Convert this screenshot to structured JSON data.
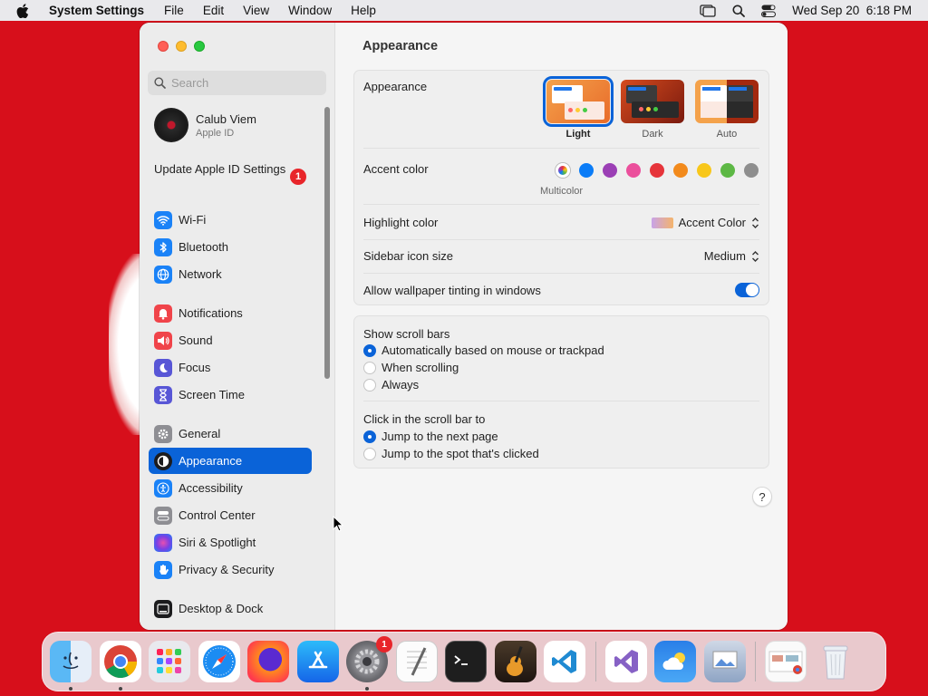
{
  "menubar": {
    "app_name": "System Settings",
    "items": [
      "File",
      "Edit",
      "View",
      "Window",
      "Help"
    ],
    "datetime": "Wed Sep 20  6:18 PM"
  },
  "sidebar": {
    "search_placeholder": "Search",
    "profile": {
      "name": "Calub Viem",
      "subtitle": "Apple ID"
    },
    "update": {
      "label": "Update Apple ID Settings",
      "badge": "1"
    },
    "items": [
      {
        "label": "Wi-Fi",
        "icon": "wifi-icon",
        "color": "#1a82f7"
      },
      {
        "label": "Bluetooth",
        "icon": "bluetooth-icon",
        "color": "#1a82f7"
      },
      {
        "label": "Network",
        "icon": "network-globe-icon",
        "color": "#1a82f7"
      },
      {
        "label": "Notifications",
        "icon": "notifications-bell-icon",
        "color": "#f0444a"
      },
      {
        "label": "Sound",
        "icon": "sound-speaker-icon",
        "color": "#f0444a"
      },
      {
        "label": "Focus",
        "icon": "focus-moon-icon",
        "color": "#5856d6"
      },
      {
        "label": "Screen Time",
        "icon": "hourglass-icon",
        "color": "#5856d6"
      },
      {
        "label": "General",
        "icon": "gear-icon",
        "color": "#8e8e93"
      },
      {
        "label": "Appearance",
        "icon": "appearance-icon",
        "color": "#1c1c1e"
      },
      {
        "label": "Accessibility",
        "icon": "accessibility-icon",
        "color": "#1a82f7"
      },
      {
        "label": "Control Center",
        "icon": "control-center-icon",
        "color": "#8e8e93"
      },
      {
        "label": "Siri & Spotlight",
        "icon": "siri-icon",
        "color": "#7b3fe4"
      },
      {
        "label": "Privacy & Security",
        "icon": "hand-icon",
        "color": "#1a82f7"
      },
      {
        "label": "Desktop & Dock",
        "icon": "desktop-dock-icon",
        "color": "#1c1c1e"
      }
    ]
  },
  "main": {
    "title": "Appearance",
    "appearance": {
      "label": "Appearance",
      "options": [
        "Light",
        "Dark",
        "Auto"
      ],
      "selected": "Light"
    },
    "accent": {
      "label": "Accent color",
      "selected_name": "Multicolor",
      "colors": [
        "#8a5cf6",
        "#0a7cf7",
        "#9b3fb5",
        "#eb4f9c",
        "#e6343a",
        "#f28a1c",
        "#f8c71a",
        "#5db845",
        "#8e8e8e"
      ]
    },
    "highlight": {
      "label": "Highlight color",
      "value": "Accent Color"
    },
    "icon_size": {
      "label": "Sidebar icon size",
      "value": "Medium"
    },
    "tinting": {
      "label": "Allow wallpaper tinting in windows",
      "on": true
    },
    "scrollbars": {
      "label": "Show scroll bars",
      "options": [
        "Automatically based on mouse or trackpad",
        "When scrolling",
        "Always"
      ],
      "selected": 0
    },
    "click": {
      "label": "Click in the scroll bar to",
      "options": [
        "Jump to the next page",
        "Jump to the spot that's clicked"
      ],
      "selected": 0
    },
    "help": "?"
  },
  "dock": {
    "apps": [
      "finder",
      "chrome",
      "launchpad",
      "safari",
      "firefox",
      "app-store",
      "system-settings",
      "textedit",
      "terminal",
      "garageband",
      "vscode",
      "visual-studio",
      "weather",
      "preview",
      "recent-chrome",
      "trash"
    ],
    "settings_badge": "1"
  }
}
